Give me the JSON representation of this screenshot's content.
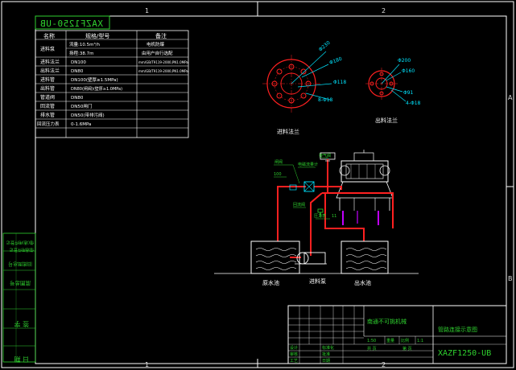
{
  "colors": {
    "background": "#000000",
    "frame": "#ffffff",
    "table_text": "#ffffff",
    "green": "#2fd12f",
    "cyan": "#00e5ff",
    "red": "#ff2020",
    "magenta": "#c000ff"
  },
  "border_marks": {
    "top": [
      "1",
      "2"
    ],
    "bottom": [
      "1",
      "2"
    ],
    "right": [
      "A",
      "B"
    ]
  },
  "drawing_code_mirrored": "XAZF1250-UB",
  "param_table": {
    "headers": [
      "名称",
      "规格/型号",
      "备注"
    ],
    "rows": [
      {
        "name": "进料泵",
        "spec": "流量:10.5m³/h",
        "note": "电机防爆"
      },
      {
        "name": "",
        "spec": "扬程:38.7m",
        "note": "由用户自行选配"
      },
      {
        "name": "进料法兰",
        "spec": "DN100",
        "note": "mm/GB/T9119-2000,PN1.0MPa"
      },
      {
        "name": "出料法兰",
        "spec": "DN80",
        "note": "mm/GB/T9119-2000,PN1.0MPa"
      },
      {
        "name": "进料管",
        "spec": "DN100(壁厚≥1.5MPa)",
        "note": ""
      },
      {
        "name": "出料管",
        "spec": "DN80(闸阀)(壁厚≥1.0MPa)",
        "note": ""
      },
      {
        "name": "管道阀",
        "spec": "DN80",
        "note": ""
      },
      {
        "name": "回流管",
        "spec": "DN50闸门",
        "note": ""
      },
      {
        "name": "排水管",
        "spec": "DN50(带排污阀)",
        "note": ""
      },
      {
        "name": "回流压力表",
        "spec": "0-1.6MPa",
        "note": ""
      }
    ]
  },
  "flange_labels": {
    "inlet": {
      "d1": "Φ230",
      "d2": "Φ180",
      "d3": "Φ118",
      "holes": "8-Φ18",
      "caption": "进料法兰"
    },
    "outlet": {
      "d1": "Φ200",
      "d2": "Φ160",
      "d3": "Φ91",
      "holes": "4-Φ18",
      "caption": "出料法兰"
    }
  },
  "pipe_labels": {
    "feed_valve": "闸阀",
    "flow_meter": "电磁流量计",
    "vent": "排气阀",
    "return_valve": "回流阀",
    "pressure_gauge": "压力表",
    "tag_a": "100",
    "tag_b": "11"
  },
  "tank_captions": {
    "feed": "原水池",
    "pump": "进料泵",
    "out": "出水池"
  },
  "title_block": {
    "company": "南通不可挑机械",
    "drawing_name": "管路连接示意图",
    "code": "XAZF1250-UB",
    "left_col": [
      "借(通)用件登记",
      "借通用件登记",
      "旧底图总号",
      "底图总号",
      "签 字",
      "日 期"
    ],
    "sign_cells": [
      "设计",
      "审核",
      "工艺",
      "标准化",
      "批准",
      "日期"
    ],
    "meta": [
      "重量",
      "比例",
      "共 页",
      "第 页"
    ],
    "meta_values": [
      "1:1",
      "1:50"
    ]
  }
}
